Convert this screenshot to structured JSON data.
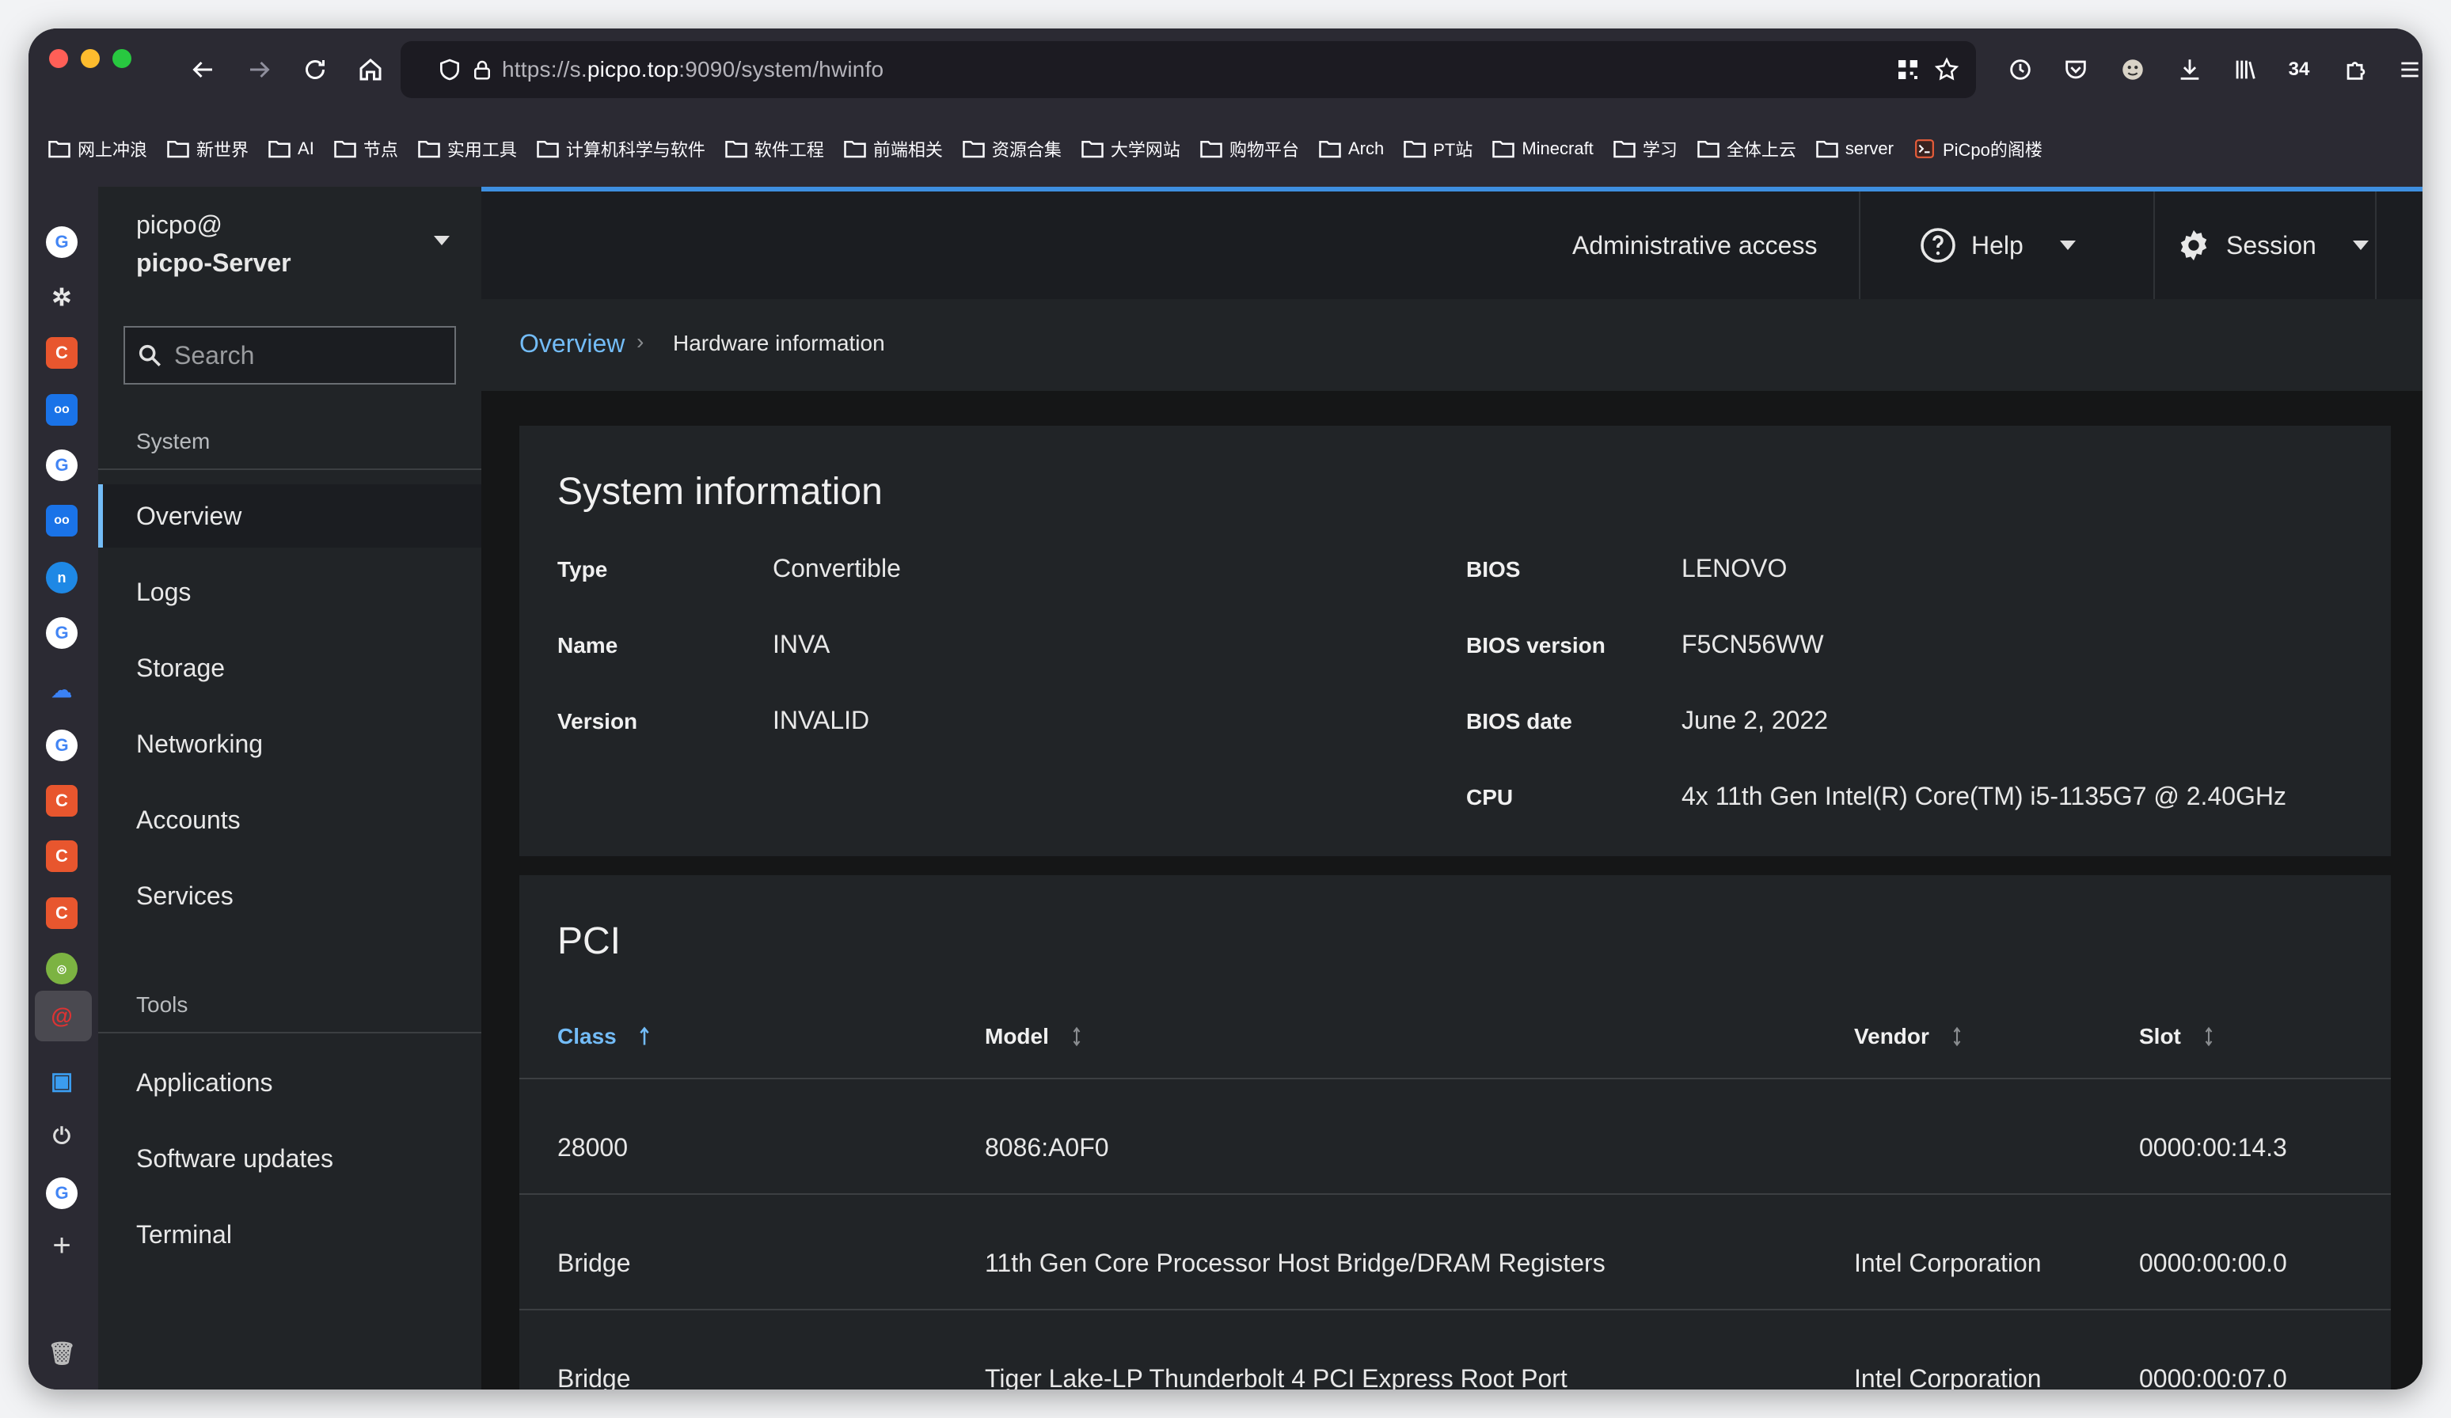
{
  "browser": {
    "url_prefix": "https://s.",
    "url_host": "picpo.top",
    "url_suffix": ":9090/system/hwinfo",
    "tab_count": "34"
  },
  "bookmarks": [
    "网上冲浪",
    "新世界",
    "AI",
    "节点",
    "实用工具",
    "计算机科学与软件",
    "软件工程",
    "前端相关",
    "资源合集",
    "大学网站",
    "购物平台",
    "Arch",
    "PT站",
    "Minecraft",
    "学习",
    "全体上云",
    "server",
    "PiCpo的阁楼"
  ],
  "nav": {
    "user": "picpo@",
    "host": "picpo-Server",
    "search_placeholder": "Search",
    "system_heading": "System",
    "system_items": [
      "Overview",
      "Logs",
      "Storage",
      "Networking",
      "Accounts",
      "Services"
    ],
    "tools_heading": "Tools",
    "tools_items": [
      "Applications",
      "Software updates",
      "Terminal"
    ]
  },
  "topbar": {
    "admin": "Administrative access",
    "help": "Help",
    "session": "Session"
  },
  "breadcrumb": {
    "link": "Overview",
    "current": "Hardware information"
  },
  "system_info": {
    "title": "System information",
    "left": [
      {
        "key": "Type",
        "value": "Convertible"
      },
      {
        "key": "Name",
        "value": "INVA"
      },
      {
        "key": "Version",
        "value": "INVALID"
      }
    ],
    "right": [
      {
        "key": "BIOS",
        "value": "LENOVO"
      },
      {
        "key": "BIOS version",
        "value": "F5CN56WW"
      },
      {
        "key": "BIOS date",
        "value": "June 2, 2022"
      },
      {
        "key": "CPU",
        "value": "4x 11th Gen Intel(R) Core(TM) i5-1135G7 @ 2.40GHz"
      }
    ]
  },
  "pci": {
    "title": "PCI",
    "columns": [
      "Class",
      "Model",
      "Vendor",
      "Slot"
    ],
    "rows": [
      {
        "class": "28000",
        "model": "8086:A0F0",
        "vendor": "",
        "slot": "0000:00:14.3"
      },
      {
        "class": "Bridge",
        "model": "11th Gen Core Processor Host Bridge/DRAM Registers",
        "vendor": "Intel Corporation",
        "slot": "0000:00:00.0"
      },
      {
        "class": "Bridge",
        "model": "Tiger Lake-LP Thunderbolt 4 PCI Express Root Port",
        "vendor": "Intel Corporation",
        "slot": "0000:00:07.0"
      }
    ]
  },
  "colors": {
    "accent": "#73bcf7",
    "page_bg": "#151617",
    "nav_bg": "#212427",
    "card_bg": "#212427"
  }
}
